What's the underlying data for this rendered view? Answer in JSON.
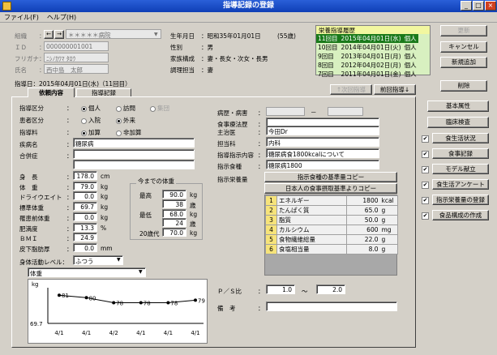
{
  "window": {
    "title": "指導記録の登録"
  },
  "menu": [
    "ファイル(F)",
    "ヘルプ(H)"
  ],
  "patient": {
    "org_label": "組織",
    "org_value": "＊＊＊＊＊病院",
    "id_label": "ＩＤ",
    "id_value": "000000001001",
    "kana_label": "フリガナ",
    "kana_value": "ﾆｼﾉｶﾜﾏ ﾀﾛｳ",
    "name_label": "氏名",
    "name_value": "西中島　太郎",
    "birth_label": "生年月日",
    "birth_value": "：昭和35年01月01日",
    "age_value": "(55歳)",
    "sex_label": "性別",
    "sex_value": "：男",
    "family_label": "家族構成",
    "family_value": "：妻・長女・次女・長男",
    "cook_label": "調理担当",
    "cook_value": "：妻"
  },
  "history": {
    "title": "栄養指導履歴",
    "rows": [
      {
        "label": "11回目",
        "date": "2015年04月01日(水)",
        "type": "個人"
      },
      {
        "label": "10回目",
        "date": "2014年04月01日(火)",
        "type": "個人"
      },
      {
        "label": "9回目",
        "date": "2013年04月01日(月)",
        "type": "個人"
      },
      {
        "label": "8回目",
        "date": "2012年04月02日(月)",
        "type": "個人"
      },
      {
        "label": "7回目",
        "date": "2011年04月01日(金)",
        "type": "個人"
      }
    ]
  },
  "right_buttons": {
    "update": "更新",
    "cancel": "キャンセル",
    "new": "新規追加",
    "delete": "削除",
    "basic": "基本属性",
    "clinical": "臨床検査",
    "life": "食生活状況",
    "meal": "食事記録",
    "model": "モデル献立",
    "survey": "食生活アンケート",
    "intake": "指示栄養量の登録",
    "composition": "食品構成の作成"
  },
  "check_mark": "✔",
  "guidance_date": "指導日：2015年04月01日(水)（11回目）",
  "nav": {
    "next": "↑次回指導",
    "prev": "前回指導↓"
  },
  "tabs": {
    "content": "依頼内容",
    "record": "指導記録"
  },
  "form": {
    "class_label": "指導区分",
    "class_opts": [
      "個人",
      "訪問",
      "集団"
    ],
    "patient_label": "患者区分",
    "patient_opts": [
      "入院",
      "外来"
    ],
    "fee_label": "指導料",
    "fee_opts": [
      "加算",
      "非加算"
    ],
    "disease_label": "疾病名",
    "disease_value": "糖尿病",
    "comp_label": "合併症",
    "comp_value": ""
  },
  "body": {
    "rows": [
      {
        "label": "身　長",
        "value": "178.0",
        "unit": "cm"
      },
      {
        "label": "体　重",
        "value": "79.0",
        "unit": "kg"
      },
      {
        "label": "ドライウエイト",
        "value": "0.0",
        "unit": "kg"
      },
      {
        "label": "標準体重",
        "value": "69.7",
        "unit": "kg"
      },
      {
        "label": "罹患前体重",
        "value": "0.0",
        "unit": "kg"
      },
      {
        "label": "肥満度",
        "value": "13.3",
        "unit": "%"
      },
      {
        "label": "ＢＭＩ",
        "value": "24.9",
        "unit": ""
      },
      {
        "label": "皮下脂肪厚",
        "value": "0.0",
        "unit": "mm"
      }
    ],
    "activity_label": "身体活動レベル：",
    "activity_value": "ふつう"
  },
  "past_weight": {
    "title": "今までの体重",
    "rows": [
      {
        "label": "最高",
        "value": "90.0",
        "unit": "kg"
      },
      {
        "label": "",
        "value": "38",
        "unit": "歳"
      },
      {
        "label": "最低",
        "value": "68.0",
        "unit": "kg"
      },
      {
        "label": "",
        "value": "24",
        "unit": "歳"
      },
      {
        "label": "20歳代",
        "value": "70.0",
        "unit": "kg"
      }
    ]
  },
  "graph_select": "体重",
  "chart_data": {
    "type": "line",
    "ylabel": "kg",
    "y_min_label": "69.7",
    "categories": [
      "4/1",
      "4/1",
      "4/2",
      "4/1",
      "4/1",
      "4/1"
    ],
    "values": [
      81,
      80,
      78,
      78,
      78,
      79
    ]
  },
  "right_form": {
    "onset_label": "病歴・病害",
    "onset_dash": "－",
    "diet_label": "食事療法歴",
    "diet_value": "",
    "doctor_label": "主治医",
    "doctor_value": "今田Dr",
    "dept_label": "担当科",
    "dept_value": "内科",
    "instr_label": "指導指示内容",
    "instr_value": "糖尿病食1800kcalについて",
    "food_label": "指示食種",
    "food_value": "糖尿病1800",
    "nutr_label": "指示栄養量",
    "copy_btn1": "指示食種の基準量コピー",
    "copy_btn2": "日本人の食事摂取基準よりコピー",
    "nutrients": [
      {
        "no": "1",
        "name": "エネルギー",
        "value": "1800",
        "unit": "kcal"
      },
      {
        "no": "2",
        "name": "たんぱく質",
        "value": "65.0",
        "unit": "g"
      },
      {
        "no": "3",
        "name": "脂質",
        "value": "50.0",
        "unit": "g"
      },
      {
        "no": "4",
        "name": "カルシウム",
        "value": "600",
        "unit": "mg"
      },
      {
        "no": "5",
        "name": "食物繊維総量",
        "value": "22.0",
        "unit": "g"
      },
      {
        "no": "6",
        "name": "食塩相当量",
        "value": "8.0",
        "unit": "g"
      }
    ],
    "ps_label": "Ｐ／Ｓ比",
    "ps_from": "1.0",
    "ps_tilde": "～",
    "ps_to": "2.0",
    "note_label": "備　考",
    "note_value": ""
  },
  "colors": {
    "title": "#0f3fb6",
    "history_bg": "#d8f0c0",
    "history_sel": "#1a7a1a",
    "nutr_no": "#f6e37a",
    "nutr_bg": "#f0f0f0"
  }
}
